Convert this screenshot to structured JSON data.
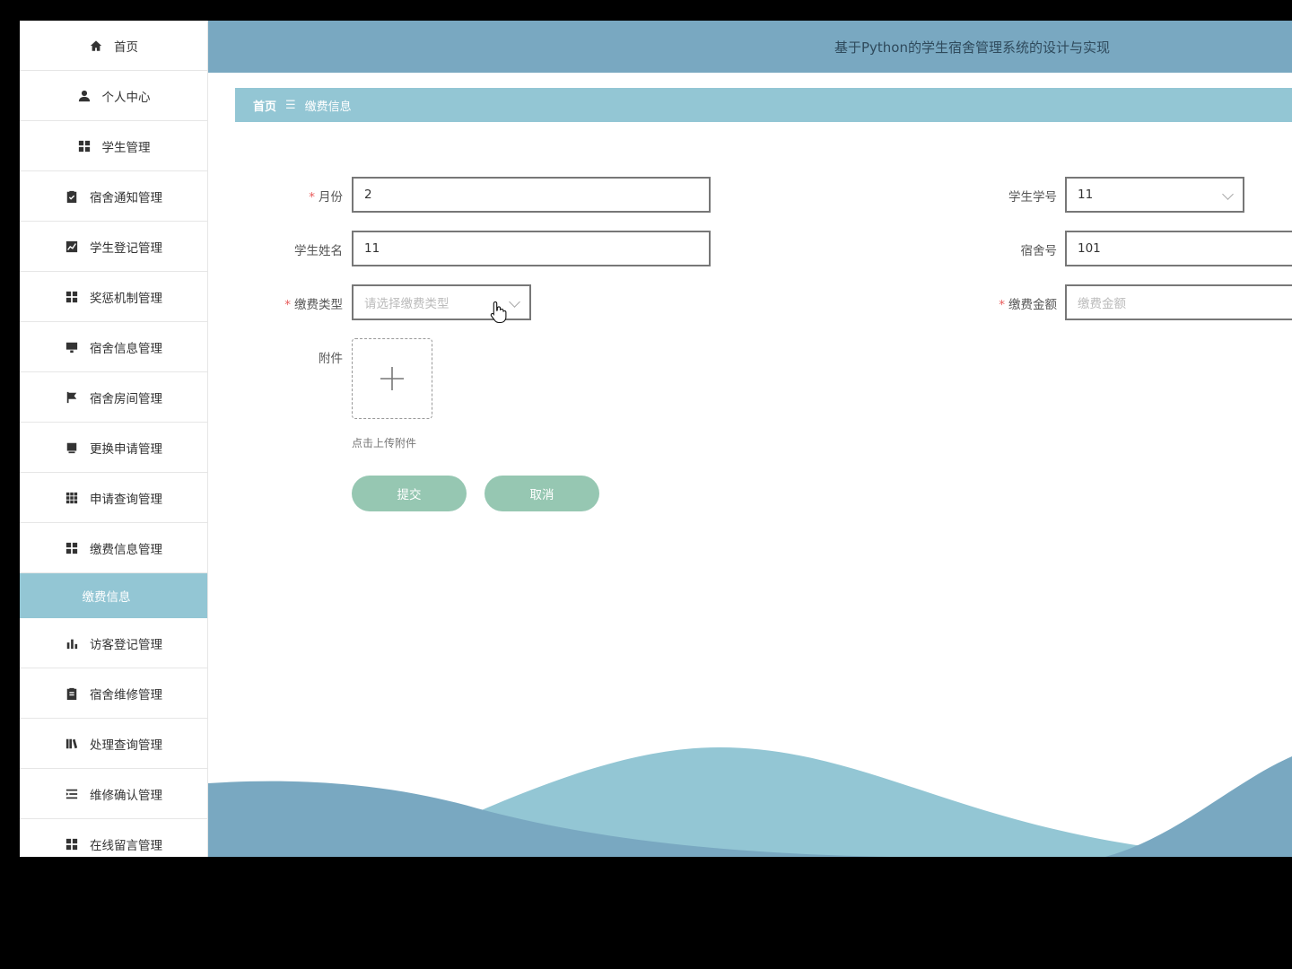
{
  "header": {
    "title": "基于Python的学生宿舍管理系统的设计与实现"
  },
  "breadcrumb": {
    "home": "首页",
    "separator": "☰",
    "current": "缴费信息"
  },
  "sidebar": {
    "items": [
      {
        "label": "首页",
        "icon": "home-icon"
      },
      {
        "label": "个人中心",
        "icon": "user-icon"
      },
      {
        "label": "学生管理",
        "icon": "grid-icon"
      },
      {
        "label": "宿舍通知管理",
        "icon": "clipboard-check-icon"
      },
      {
        "label": "学生登记管理",
        "icon": "line-chart-icon"
      },
      {
        "label": "奖惩机制管理",
        "icon": "grid-icon"
      },
      {
        "label": "宿舍信息管理",
        "icon": "monitor-icon"
      },
      {
        "label": "宿舍房间管理",
        "icon": "flag-icon"
      },
      {
        "label": "更换申请管理",
        "icon": "book-icon"
      },
      {
        "label": "申请查询管理",
        "icon": "apps-icon"
      },
      {
        "label": "缴费信息管理",
        "icon": "grid-icon"
      }
    ],
    "active_sub": "缴费信息",
    "items_after": [
      {
        "label": "访客登记管理",
        "icon": "bar-chart-icon"
      },
      {
        "label": "宿舍维修管理",
        "icon": "clipboard-icon"
      },
      {
        "label": "处理查询管理",
        "icon": "library-icon"
      },
      {
        "label": "维修确认管理",
        "icon": "list-indent-icon"
      },
      {
        "label": "在线留言管理",
        "icon": "grid-icon"
      }
    ]
  },
  "form": {
    "month": {
      "label": "月份",
      "required": "*",
      "value": "2"
    },
    "student_no": {
      "label": "学生学号",
      "value": "11"
    },
    "student_name": {
      "label": "学生姓名",
      "value": "11"
    },
    "dorm_no": {
      "label": "宿舍号",
      "value": "101"
    },
    "fee_type": {
      "label": "缴费类型",
      "required": "*",
      "placeholder": "请选择缴费类型"
    },
    "fee_amount": {
      "label": "缴费金额",
      "required": "*",
      "placeholder": "缴费金额"
    },
    "attachment": {
      "label": "附件",
      "tip": "点击上传附件"
    },
    "submit_label": "提交",
    "cancel_label": "取消"
  },
  "colors": {
    "header": "#79a8c1",
    "breadcrumb": "#93c6d4",
    "button": "#96c7b2",
    "wave_dark": "#79a8c1",
    "wave_light": "#93c6d4"
  }
}
